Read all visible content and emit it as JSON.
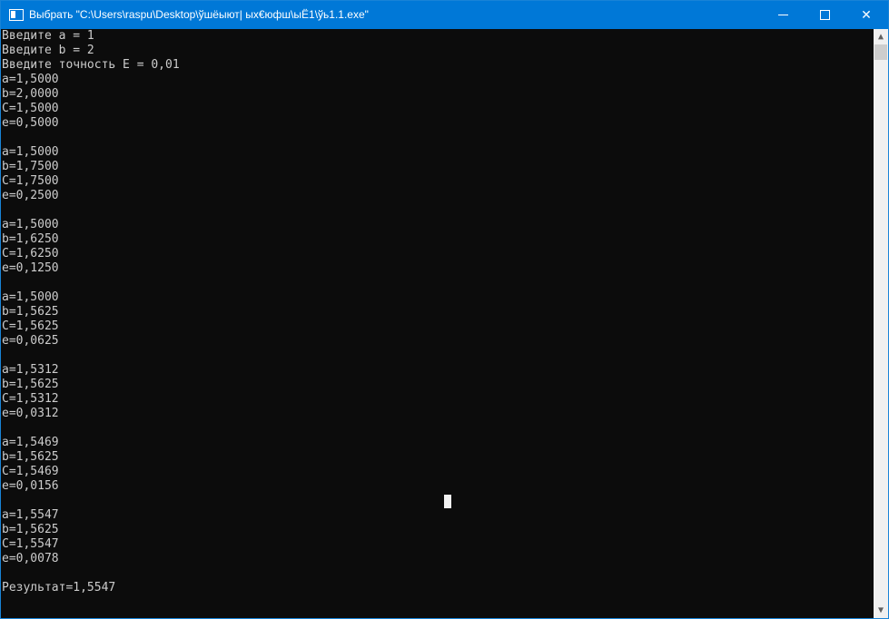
{
  "window": {
    "title": "Выбрать \"C:\\Users\\raspu\\Desktop\\ўшёыют| ых€юфш\\ыЁ1\\ўь1.1.exe\""
  },
  "icons": {
    "minimize": "minimize-icon",
    "maximize": "maximize-icon",
    "close": "close-icon"
  },
  "console": {
    "lines": [
      "Введите a = 1",
      "Введите b = 2",
      "Введите точность E = 0,01",
      "a=1,5000",
      "b=2,0000",
      "C=1,5000",
      "e=0,5000",
      "",
      "a=1,5000",
      "b=1,7500",
      "C=1,7500",
      "e=0,2500",
      "",
      "a=1,5000",
      "b=1,6250",
      "C=1,6250",
      "e=0,1250",
      "",
      "a=1,5000",
      "b=1,5625",
      "C=1,5625",
      "e=0,0625",
      "",
      "a=1,5312",
      "b=1,5625",
      "C=1,5312",
      "e=0,0312",
      "",
      "a=1,5469",
      "b=1,5625",
      "C=1,5469",
      "e=0,0156",
      "",
      "a=1,5547",
      "b=1,5625",
      "C=1,5547",
      "e=0,0078",
      "",
      "Результат=1,5547"
    ]
  }
}
